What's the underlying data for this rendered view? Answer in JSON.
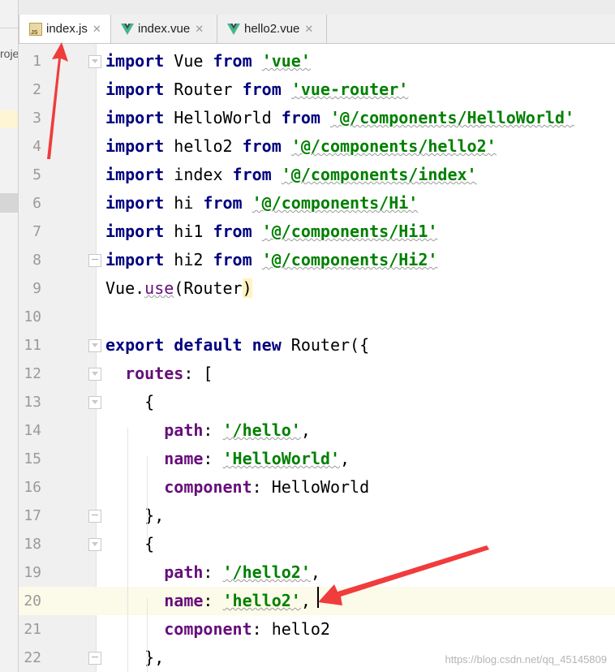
{
  "side_panel": {
    "label": "roje"
  },
  "tabs": [
    {
      "label": "index.js",
      "icon": "js-file-icon",
      "active": true
    },
    {
      "label": "index.vue",
      "icon": "vue-file-icon",
      "active": false
    },
    {
      "label": "hello2.vue",
      "icon": "vue-file-icon",
      "active": false
    }
  ],
  "editor": {
    "current_line": 20,
    "lines": [
      {
        "n": "1",
        "fold": "open",
        "tokens": [
          [
            "kw",
            "import"
          ],
          [
            "",
            "Vue "
          ],
          [
            "kw",
            "from "
          ],
          [
            "str",
            "'vue'"
          ]
        ]
      },
      {
        "n": "2",
        "fold": "",
        "tokens": [
          [
            "kw",
            "import"
          ],
          [
            "",
            "Router "
          ],
          [
            "kw",
            "from "
          ],
          [
            "str",
            "'vue-router'"
          ]
        ]
      },
      {
        "n": "3",
        "fold": "",
        "tokens": [
          [
            "kw",
            "import"
          ],
          [
            "",
            "HelloWorld "
          ],
          [
            "kw",
            "from "
          ],
          [
            "str",
            "'@/components/HelloWorld'"
          ]
        ]
      },
      {
        "n": "4",
        "fold": "",
        "tokens": [
          [
            "kw",
            "import"
          ],
          [
            "",
            "hello2 "
          ],
          [
            "kw",
            "from "
          ],
          [
            "str",
            "'@/components/hello2'"
          ]
        ]
      },
      {
        "n": "5",
        "fold": "",
        "tokens": [
          [
            "kw",
            "import"
          ],
          [
            "",
            "index "
          ],
          [
            "kw",
            "from "
          ],
          [
            "str",
            "'@/components/index'"
          ]
        ]
      },
      {
        "n": "6",
        "fold": "",
        "tokens": [
          [
            "kw",
            "import"
          ],
          [
            "",
            "hi "
          ],
          [
            "kw",
            "from "
          ],
          [
            "str",
            "'@/components/Hi'"
          ]
        ]
      },
      {
        "n": "7",
        "fold": "",
        "tokens": [
          [
            "kw",
            "import"
          ],
          [
            "",
            "hi1 "
          ],
          [
            "kw",
            "from "
          ],
          [
            "str",
            "'@/components/Hi1'"
          ]
        ]
      },
      {
        "n": "8",
        "fold": "close",
        "tokens": [
          [
            "kw",
            "import"
          ],
          [
            "",
            "hi2 "
          ],
          [
            "kw",
            "from "
          ],
          [
            "str",
            "'@/components/Hi2'"
          ]
        ]
      },
      {
        "n": "9",
        "fold": "",
        "tokens": [
          [
            "",
            "Vue."
          ],
          [
            "mth",
            "use"
          ],
          [
            "",
            "(Router"
          ],
          [
            "brace",
            ")"
          ]
        ]
      },
      {
        "n": "10",
        "fold": "",
        "tokens": []
      },
      {
        "n": "11",
        "fold": "open",
        "tokens": [
          [
            "kw",
            "export default new "
          ],
          [
            "",
            "Router({"
          ]
        ]
      },
      {
        "n": "12",
        "fold": "open",
        "tokens": [
          [
            "",
            "  "
          ],
          [
            "prop",
            "routes"
          ],
          [
            "",
            ": ["
          ]
        ]
      },
      {
        "n": "13",
        "fold": "open",
        "tokens": [
          [
            "",
            "    {"
          ]
        ]
      },
      {
        "n": "14",
        "fold": "",
        "tokens": [
          [
            "",
            "      "
          ],
          [
            "prop",
            "path"
          ],
          [
            "",
            ": "
          ],
          [
            "str",
            "'/hello'"
          ],
          [
            "",
            ","
          ]
        ]
      },
      {
        "n": "15",
        "fold": "",
        "tokens": [
          [
            "",
            "      "
          ],
          [
            "prop",
            "name"
          ],
          [
            "",
            ": "
          ],
          [
            "str",
            "'HelloWorld'"
          ],
          [
            "",
            ","
          ]
        ]
      },
      {
        "n": "16",
        "fold": "",
        "tokens": [
          [
            "",
            "      "
          ],
          [
            "prop",
            "component"
          ],
          [
            "",
            ": HelloWorld"
          ]
        ]
      },
      {
        "n": "17",
        "fold": "close",
        "tokens": [
          [
            "",
            "    },"
          ]
        ]
      },
      {
        "n": "18",
        "fold": "open",
        "tokens": [
          [
            "",
            "    {"
          ]
        ]
      },
      {
        "n": "19",
        "fold": "",
        "tokens": [
          [
            "",
            "      "
          ],
          [
            "prop",
            "path"
          ],
          [
            "",
            ": "
          ],
          [
            "str",
            "'/hello2'"
          ],
          [
            "",
            ","
          ]
        ]
      },
      {
        "n": "20",
        "fold": "",
        "tokens": [
          [
            "",
            "      "
          ],
          [
            "prop",
            "name"
          ],
          [
            "",
            ": "
          ],
          [
            "str",
            "'hello2'"
          ],
          [
            "",
            ","
          ]
        ]
      },
      {
        "n": "21",
        "fold": "",
        "tokens": [
          [
            "",
            "      "
          ],
          [
            "prop",
            "component"
          ],
          [
            "",
            ": hello2"
          ]
        ]
      },
      {
        "n": "22",
        "fold": "close",
        "tokens": [
          [
            "",
            "    },"
          ]
        ]
      }
    ]
  },
  "watermark": "https://blog.csdn.net/qq_45145809",
  "colors": {
    "keyword": "#000080",
    "string": "#008000",
    "property": "#660e7a",
    "arrow": "#f03c3c"
  }
}
